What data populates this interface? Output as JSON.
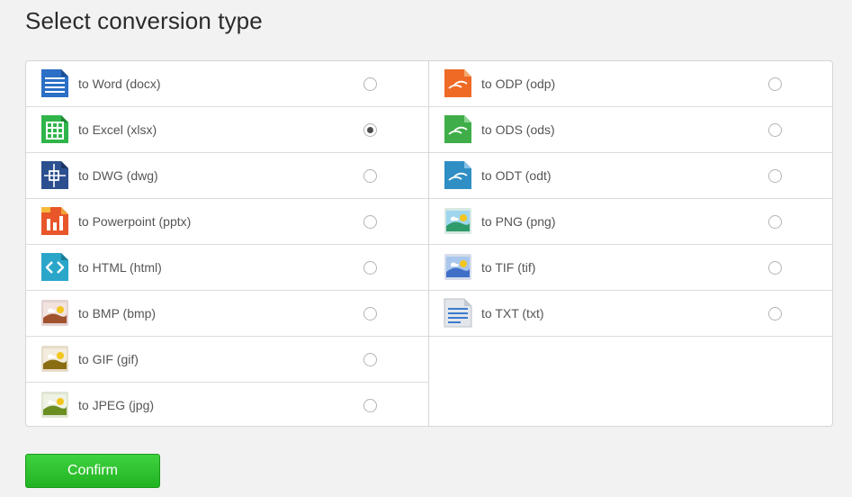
{
  "page": {
    "title": "Select conversion type",
    "confirm_label": "Confirm"
  },
  "options": {
    "left": [
      {
        "label": "to Word (docx)",
        "icon": "word-doc-icon",
        "selected": false
      },
      {
        "label": "to Excel (xlsx)",
        "icon": "excel-sheet-icon",
        "selected": true
      },
      {
        "label": "to DWG (dwg)",
        "icon": "dwg-cad-icon",
        "selected": false
      },
      {
        "label": "to Powerpoint (pptx)",
        "icon": "powerpoint-icon",
        "selected": false
      },
      {
        "label": "to HTML (html)",
        "icon": "html-code-icon",
        "selected": false
      },
      {
        "label": "to BMP (bmp)",
        "icon": "bmp-image-icon",
        "selected": false
      },
      {
        "label": "to GIF (gif)",
        "icon": "gif-image-icon",
        "selected": false
      },
      {
        "label": "to JPEG (jpg)",
        "icon": "jpeg-image-icon",
        "selected": false
      }
    ],
    "right": [
      {
        "label": "to ODP (odp)",
        "icon": "odp-presentation-icon",
        "selected": false
      },
      {
        "label": "to ODS (ods)",
        "icon": "ods-spreadsheet-icon",
        "selected": false
      },
      {
        "label": "to ODT (odt)",
        "icon": "odt-text-icon",
        "selected": false
      },
      {
        "label": "to PNG (png)",
        "icon": "png-image-icon",
        "selected": false
      },
      {
        "label": "to TIF (tif)",
        "icon": "tif-image-icon",
        "selected": false
      },
      {
        "label": "to TXT (txt)",
        "icon": "txt-file-icon",
        "selected": false
      }
    ]
  },
  "colors": {
    "confirm_button": "#2bbf2b",
    "word": "#2b6fc6",
    "excel": "#2fb54a",
    "dwg": "#2c4f8f",
    "powerpoint": "#e8562a",
    "html": "#2aa6c9",
    "odp": "#ef6a25",
    "ods": "#3fae49",
    "odt": "#2f8fc4"
  }
}
